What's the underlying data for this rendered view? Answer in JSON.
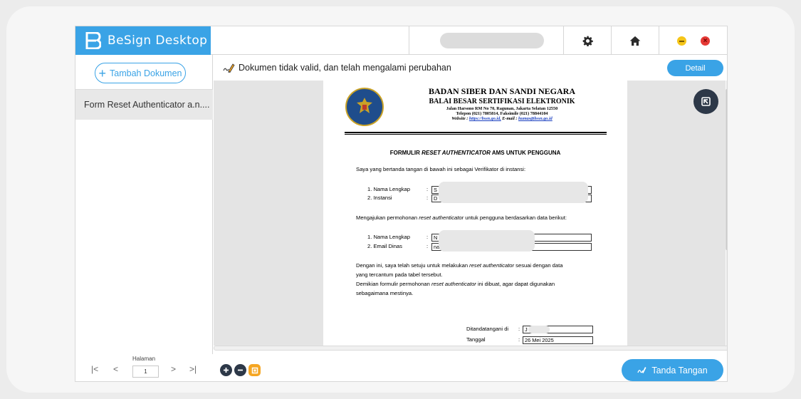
{
  "app": {
    "brand_name": "BeSign Desktop"
  },
  "topbar": {
    "icons": [
      "gear-icon",
      "home-icon",
      "minimize-icon",
      "close-icon"
    ],
    "minimize_color": "#f5c518",
    "close_color": "#e53935"
  },
  "sidebar": {
    "add_button_label": "Tambah Dokumen",
    "documents": [
      {
        "label": "Form Reset Authenticator a.n...."
      }
    ]
  },
  "status": {
    "message": "Dokumen tidak valid, dan telah mengalami perubahan",
    "detail_button": "Detail"
  },
  "document": {
    "header": {
      "line1": "BADAN SIBER DAN SANDI NEGARA",
      "line2": "BALAI BESAR SERTIFIKASI ELEKTRONIK",
      "line3": "Jalan Harsono RM No 70, Ragunan, Jakarta Selatan 12550",
      "line4": "Telepon (021) 7805814,  Faksimile (021) 78844104",
      "line5_prefix": "Website : ",
      "website": "https://bssn.go.id,",
      "line5_mid": " E-mail : ",
      "email": "humas@bssn.go.id"
    },
    "form_title_1": "FORMULIR ",
    "form_title_2": "RESET AUTHENTICATOR",
    "form_title_3": " AMS UNTUK PENGGUNA",
    "intro": "Saya yang bertanda tangan di bawah ini sebagai Verifikator di instansi:",
    "verifier_fields": [
      {
        "label": "1.  Nama Lengkap",
        "value": "S"
      },
      {
        "label": "2.  Instansi",
        "value": "D"
      }
    ],
    "request_1": "Mengajukan permohonan ",
    "request_2": "reset authenticator",
    "request_3": " untuk pengguna berdasarkan data berikut:",
    "user_fields": [
      {
        "label": "1.  Nama Lengkap",
        "value": "N"
      },
      {
        "label": "2.  Email Dinas",
        "value": "na"
      }
    ],
    "para1_a": "Dengan ini, saya telah setuju untuk melakukan ",
    "para1_b": "reset authenticator",
    "para1_c": " sesuai dengan data",
    "para1_d": "yang tercantum pada tabel tersebut.",
    "para2_a": "Demikian formulir permohonan ",
    "para2_b": "reset authenticator",
    "para2_c": " ini dibuat, agar dapat digunakan",
    "para2_d": "sebagaimana mestinya.",
    "signed_at_label": "Ditandatangani di",
    "signed_at_value": "J",
    "date_label": "Tanggal",
    "date_value": "26 Mei 2025"
  },
  "bottom": {
    "page_label": "Halaman",
    "page_value": "1",
    "nav": {
      "first": "|<",
      "prev": "<",
      "next": ">",
      "last": ">|"
    },
    "sign_button": "Tanda Tangan",
    "zoom_in_color": "#2d3848",
    "zoom_out_color": "#2d3848",
    "fit_color": "#f5a623"
  },
  "accent_color": "#3aa3e6"
}
